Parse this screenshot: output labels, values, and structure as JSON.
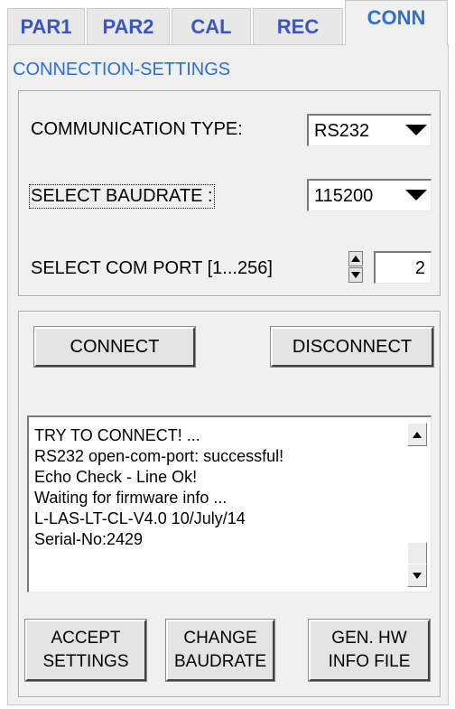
{
  "tabs": [
    {
      "label": "PAR1"
    },
    {
      "label": "PAR2"
    },
    {
      "label": "CAL"
    },
    {
      "label": "REC"
    },
    {
      "label": "CONN",
      "active": true
    }
  ],
  "section_title": "CONNECTION-SETTINGS",
  "settings": {
    "communication_type_label": "COMMUNICATION TYPE:",
    "communication_type_value": "RS232",
    "baudrate_label": "SELECT BAUDRATE :",
    "baudrate_value": "115200",
    "com_port_label": "SELECT COM PORT [1...256]",
    "com_port_value": "2"
  },
  "connection": {
    "connect_label": "CONNECT",
    "disconnect_label": "DISCONNECT",
    "log_lines": [
      "TRY TO CONNECT! ...",
      "RS232 open-com-port: successful!",
      "Echo Check - Line Ok!",
      "Waiting for firmware info ...",
      "L-LAS-LT-CL-V4.0   10/July/14",
      "Serial-No:2429"
    ]
  },
  "actions": {
    "accept_line1": "ACCEPT",
    "accept_line2": "SETTINGS",
    "change_line1": "CHANGE",
    "change_line2": "BAUDRATE",
    "gen_line1": "GEN. HW",
    "gen_line2": "INFO FILE"
  },
  "colors": {
    "tab_text": "#3a55c6",
    "active_tab_text": "#2c6fd8",
    "panel_bg": "#f0f0f0"
  },
  "icons": [
    "dropdown-arrow-icon",
    "spinner-up-icon",
    "spinner-down-icon",
    "scroll-up-icon",
    "scroll-down-icon"
  ]
}
